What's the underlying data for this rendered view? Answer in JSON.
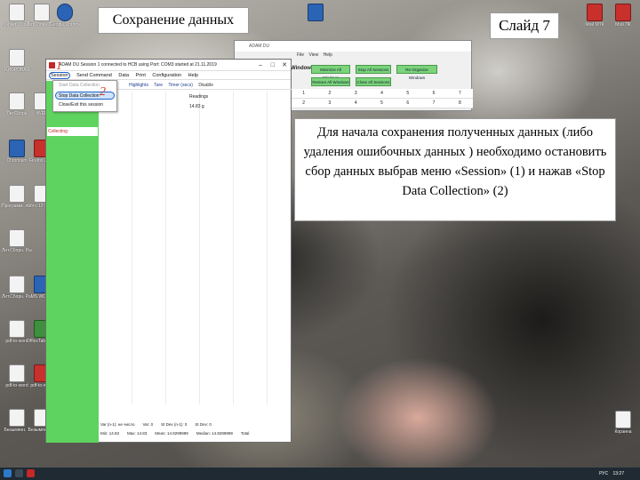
{
  "slide_title": "Сохранение данных",
  "slide_number": "Слайд 7",
  "description": "Для начала сохранения полученных данных (либо удаления ошибочных данных ) необходимо остановить сбор данных выбрав меню «Session» (1) и нажав «Stop Data Collection» (2)",
  "annotations": {
    "one": "1",
    "two": "2"
  },
  "desktop_icons": {
    "i1": "Маркет Соллого",
    "i2": "ЛитСборн Соллого",
    "i3": "Google Chrome",
    "i4": "ЦИФРОВАЯ",
    "i5": "ЛетСборн",
    "i6": "iWEB",
    "i7": "Chromium",
    "i8": "Firefox 2000",
    "i9": "Программ. лаборат.",
    "i10": "Фото 12 Skype",
    "i11": "Лит.Сборн. Разработки",
    "i12": "Лит.Сборн. Разработки",
    "i13": "MS WORD",
    "i14": "pdf-to-word",
    "i15": "OfficeTab Center",
    "i16": "Безымянн. 1",
    "i17": "Безымянн. ot",
    "i18": "Корзина",
    "i19": "Мой МТК",
    "i20": "Мой ПК"
  },
  "bg_window": {
    "title": "ADAM DU",
    "menu": [
      "File",
      "View",
      "Help"
    ],
    "window_label": "Window",
    "buttons": [
      "Minimize All Windows",
      "Stop All Sessions",
      "Re-Organize Windows",
      "Restore All Windows",
      "Close All Sessions"
    ],
    "row1": [
      "1",
      "2",
      "3",
      "4",
      "5",
      "6",
      "7"
    ],
    "row2": [
      "2",
      "3",
      "4",
      "5",
      "6",
      "7",
      "8"
    ]
  },
  "app_window": {
    "title": "ADAM DU Session 1 connected to HCB using Port: COM3 started at 21.11.2019",
    "menu": [
      "Session",
      "Send Command",
      "Data",
      "Print",
      "Configuration",
      "Help"
    ],
    "toolbar": [
      "Highlights",
      "Tare",
      "Timer (secs)",
      "Disable"
    ],
    "status": "Collecting",
    "column_header": "Readings",
    "column_value": "14.83 g",
    "dropdown": [
      "Start Data Collection",
      "Stop Data Collection",
      "Close/Exit this session"
    ],
    "stats_row1": [
      "Var (n-1): не число",
      "Var: 0",
      "St Dev (n-1): 0",
      "St Dev: 0"
    ],
    "stats_row2": [
      "Min: 14.83",
      "Max: 14.83",
      "Mean: 14.8299999",
      "Median: 14.8299999",
      "Total"
    ]
  },
  "taskbar": {
    "lang": "РУС",
    "time": "13:27"
  },
  "colors": {
    "accent_green": "#5fd35f",
    "annotation_red": "#d0342c"
  }
}
